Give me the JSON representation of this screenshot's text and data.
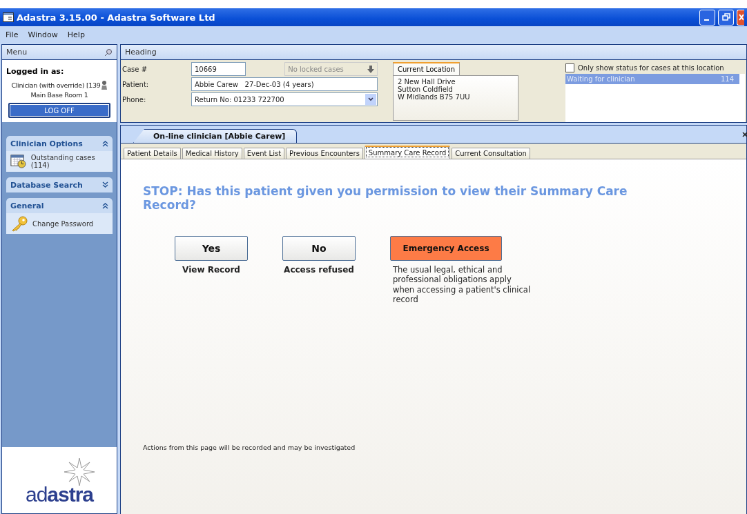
{
  "window": {
    "title": "Adastra 3.15.00 - Adastra Software Ltd"
  },
  "menu_bar": [
    "File",
    "Window",
    "Help"
  ],
  "menu_panel": {
    "title": "Menu",
    "logged_in_label": "Logged in as:",
    "user": "Clinician (with override) [139",
    "location": "Main Base Room 1",
    "logoff_button": "LOG OFF",
    "groups": [
      {
        "title": "Clinician Options",
        "expanded": true,
        "items": [
          {
            "label": "Outstanding cases (114)",
            "kind": "calendar"
          }
        ]
      },
      {
        "title": "Database Search",
        "expanded": false
      },
      {
        "title": "General",
        "expanded": true,
        "items": [
          {
            "label": "Change Password",
            "kind": "key"
          }
        ]
      }
    ],
    "logo": "ad**astra**"
  },
  "heading": {
    "title": "Heading",
    "case_label": "Case #",
    "case_value": "10669",
    "locked_cases": "No locked cases",
    "patient_label": "Patient:",
    "patient_value": "Abbie Carew   27-Dec-03 (4 years)",
    "phone_label": "Phone:",
    "phone_value": "Return No: 01233 722700",
    "location_tab": "Current Location",
    "location_lines": [
      "2 New Hall Drive",
      "Sutton Coldfield",
      "W Midlands B75 7UU"
    ],
    "status_filter": {
      "label": "Only show status for cases at this location",
      "checked": false
    },
    "status_list": [
      {
        "label": "Waiting for clinician",
        "count": "114",
        "selected": true
      }
    ]
  },
  "document_tab": "On-line clinician [Abbie Carew]",
  "tabs": [
    {
      "label": "Patient Details",
      "selected": false
    },
    {
      "label": "Medical History",
      "selected": false
    },
    {
      "label": "Event List",
      "selected": false
    },
    {
      "label": "Previous Encounters",
      "selected": false
    },
    {
      "label": "Summary Care Record",
      "selected": true
    },
    {
      "label": "Current Consultation",
      "selected": false
    }
  ],
  "content": {
    "question": "STOP: Has this patient given you permission to view their Summary Care Record?",
    "options": [
      {
        "kind": "normal",
        "button": "Yes",
        "caption": "View Record"
      },
      {
        "kind": "normal",
        "button": "No",
        "caption": "Access refused"
      },
      {
        "kind": "emergency",
        "button": "Emergency Access",
        "caption": "The usual legal, ethical and professional obligations apply when accessing a patient's clinical record"
      }
    ],
    "footer": "Actions from this page will be recorded and may be investigated"
  }
}
